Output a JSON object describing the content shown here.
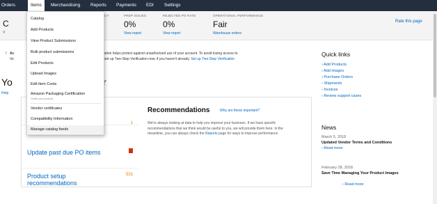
{
  "nav": {
    "items": [
      "Orders",
      "Items",
      "Merchandising",
      "Reports",
      "Payments",
      "EDI",
      "Settings"
    ],
    "active": "Items"
  },
  "metrics": {
    "col0_value": "C",
    "col0_link": "V",
    "partial_label": "CY",
    "prep_label": "PREP ISSUES",
    "prep_value": "0%",
    "prep_link": "View report",
    "rejected_label": "REJECTED PO RATE",
    "rejected_value": "0%",
    "rejected_link": "View report",
    "perf_label": "OPERATIONAL PERFORMANCE",
    "perf_value": "Fair",
    "perf_link": "Warehouse orders",
    "rate_link": "Rate this page"
  },
  "dropdown": {
    "items": [
      "Catalog",
      "Add Products",
      "View Product Submissions",
      "Bulk product submissions",
      "Edit Products",
      "Upload Images",
      "Edit Item Costs",
      "Amazon Packaging Certification",
      "Vendor certificates",
      "Compatibility Information",
      "Manage catalog feeds"
    ],
    "packaging_sub": "Certify your products",
    "highlighted": "Manage catalog feeds"
  },
  "alert": {
    "title": "Ac",
    "line1_tail": "o-Step Verification helps protect against unauthorized use of your account. To avoid losing access to",
    "line2_head": "Ve",
    "line2_mid": "nds that you set up Two-Step Verification now, if you haven't already.",
    "line2_link": "Set up Two-Step Verification"
  },
  "heading": {
    "left": "Yo",
    "right": "r",
    "help": "Help"
  },
  "cards": {
    "top_partial": "ts",
    "top_count": "1",
    "po_title": "Update past due PO items",
    "product_title": "Product setup recommendations",
    "product_count": "531"
  },
  "recommendations": {
    "title": "Recommendations",
    "why": "Why are these important?",
    "body_pre": "We're always looking at data to help you improve your business. If we have specific recommendations that we think would be useful to you, we will provide them here. In the meantime, you can always check the",
    "body_link": "Reports",
    "body_post": "page for ways to improve performance."
  },
  "quick_links": {
    "heading": "Quick links",
    "items": [
      "Add Products",
      "Add images",
      "Purchase Orders",
      "Shipments",
      "Invoices",
      "Review support cases"
    ]
  },
  "news": {
    "heading": "News",
    "items": [
      {
        "date": "March 5, 2018",
        "title": "Updated Vendor Terms and Conditions",
        "more": "Read more"
      },
      {
        "date": "February 28, 2018",
        "title": "Save Time Managing Your Product Images",
        "more": "Read more"
      }
    ]
  },
  "colors": {
    "nav_bg": "#232f3e",
    "link": "#0066c0",
    "count_orange": "#e47911",
    "flag_red": "#d13212"
  }
}
